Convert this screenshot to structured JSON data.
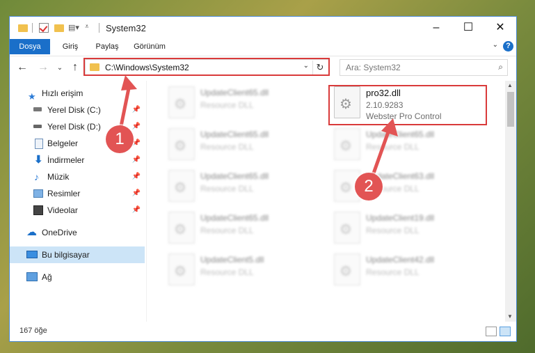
{
  "window": {
    "title": "System32"
  },
  "ribbon": {
    "tabs": [
      "Dosya",
      "Giriş",
      "Paylaş",
      "Görünüm"
    ]
  },
  "nav": {
    "address": "C:\\Windows\\System32",
    "search_placeholder": "Ara: System32"
  },
  "sidebar": {
    "items": [
      {
        "label": "Hızlı erişim",
        "icon": "star-icon"
      },
      {
        "label": "Yerel Disk (C:)",
        "icon": "disk-icon"
      },
      {
        "label": "Yerel Disk (D:)",
        "icon": "disk-icon"
      },
      {
        "label": "Belgeler",
        "icon": "documents-icon"
      },
      {
        "label": "İndirmeler",
        "icon": "download-icon"
      },
      {
        "label": "Müzik",
        "icon": "music-icon"
      },
      {
        "label": "Resimler",
        "icon": "pictures-icon"
      },
      {
        "label": "Videolar",
        "icon": "videos-icon"
      },
      {
        "label": "OneDrive",
        "icon": "cloud-icon"
      },
      {
        "label": "Bu bilgisayar",
        "icon": "computer-icon"
      },
      {
        "label": "Ağ",
        "icon": "network-icon"
      }
    ]
  },
  "files": {
    "left": [
      {
        "name": "UpdateClient65.dll",
        "desc": "Resource DLL"
      },
      {
        "name": "UpdateClient65.dll",
        "desc": "Resource DLL"
      },
      {
        "name": "UpdateClient65.dll",
        "desc": "Resource DLL"
      },
      {
        "name": "UpdateClient65.dll",
        "desc": "Resource DLL"
      },
      {
        "name": "UpdateClient5.dll",
        "desc": "Resource DLL"
      }
    ],
    "right": [
      {
        "name": "UpdateClient65.dll",
        "desc": "Resource DLL"
      },
      {
        "name": "UpdateClient63.dll",
        "desc": "Resource DLL"
      },
      {
        "name": "UpdateClient19.dll",
        "desc": "Resource DLL"
      },
      {
        "name": "UpdateClient42.dll",
        "desc": "Resource DLL"
      }
    ],
    "focus": {
      "name": "pro32.dll",
      "version": "2.10.9283",
      "desc": "Webster Pro Control"
    }
  },
  "status": {
    "count": "167 öğe"
  },
  "annotations": {
    "badge1": "1",
    "badge2": "2",
    "highlight_color": "#d93a3a"
  },
  "colors": {
    "accent": "#1a6fc9",
    "selected": "#cce4f7"
  }
}
